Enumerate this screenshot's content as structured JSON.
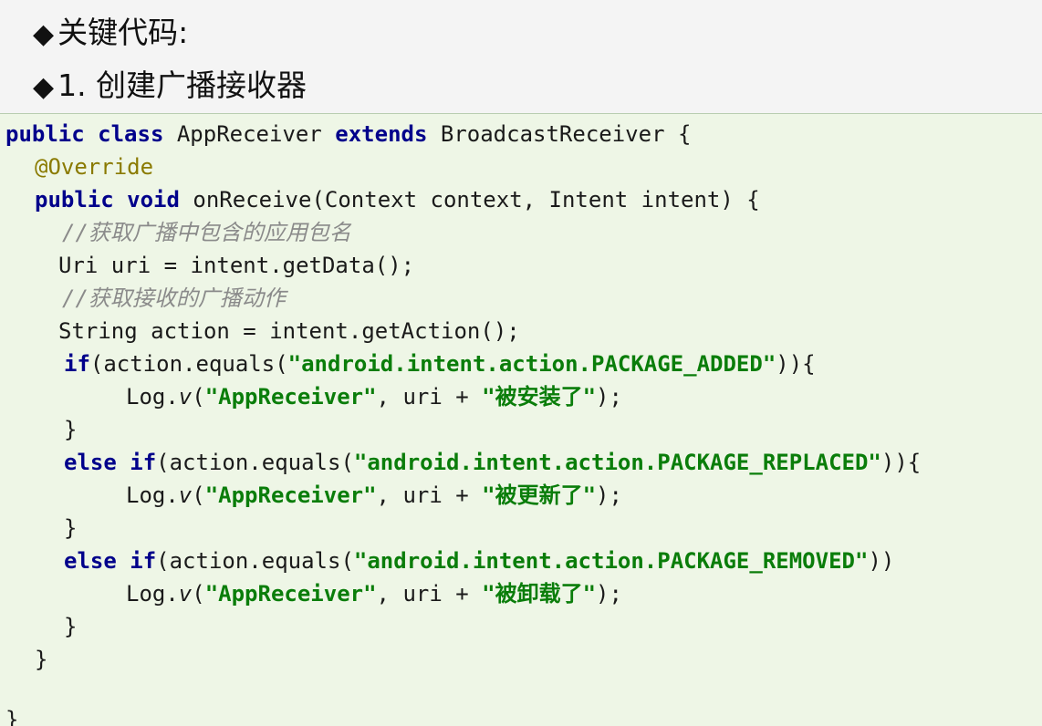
{
  "heading_1": "关键代码:",
  "heading_2": "1. 创建广播接收器",
  "bullet": "◆",
  "code": {
    "l1_kw1": "public",
    "l1_kw2": "class",
    "l1_name": "AppReceiver",
    "l1_kw3": "extends",
    "l1_rest": "BroadcastReceiver {",
    "l2_ann": "@Override",
    "l3_kw1": "public",
    "l3_kw2": "void",
    "l3_rest": "onReceive(Context context, Intent intent) {",
    "l4_cmt": "//获取广播中包含的应用包名",
    "l5": "Uri uri = intent.getData();",
    "l6_cmt": "//获取接收的广播动作",
    "l7": "String action = intent.getAction();",
    "l8_kw": "if",
    "l8_pre": "(action.equals(",
    "l8_str": "\"android.intent.action.PACKAGE_ADDED\"",
    "l8_post": ")){",
    "l9_pre": "Log.",
    "l9_v": "v",
    "l9_mid": "(",
    "l9_tag": "\"AppReceiver\"",
    "l9_mid2": ", uri + ",
    "l9_msg": "\"被安装了\"",
    "l9_post": ");",
    "l10": "}",
    "l11_kw1": "else",
    "l11_kw2": "if",
    "l11_pre": "(action.equals(",
    "l11_str": "\"android.intent.action.PACKAGE_REPLACED\"",
    "l11_post": ")){",
    "l12_pre": "Log.",
    "l12_v": "v",
    "l12_mid": "(",
    "l12_tag": "\"AppReceiver\"",
    "l12_mid2": ", uri + ",
    "l12_msg": "\"被更新了\"",
    "l12_post": ");",
    "l13": "}",
    "l14_kw1": "else",
    "l14_kw2": "if",
    "l14_pre": "(action.equals(",
    "l14_str": "\"android.intent.action.PACKAGE_REMOVED\"",
    "l14_post": "))",
    "l15_pre": "Log.",
    "l15_v": "v",
    "l15_mid": "(",
    "l15_tag": "\"AppReceiver\"",
    "l15_mid2": ", uri + ",
    "l15_msg": "\"被卸载了\"",
    "l15_post": ");",
    "l16": "}",
    "l17": "}",
    "l18": "}"
  },
  "colors": {
    "keyword": "#00008b",
    "annotation": "#8a7a00",
    "comment": "#8a8a8a",
    "string": "#0a7d0a",
    "code_background": "#eef6e6"
  }
}
